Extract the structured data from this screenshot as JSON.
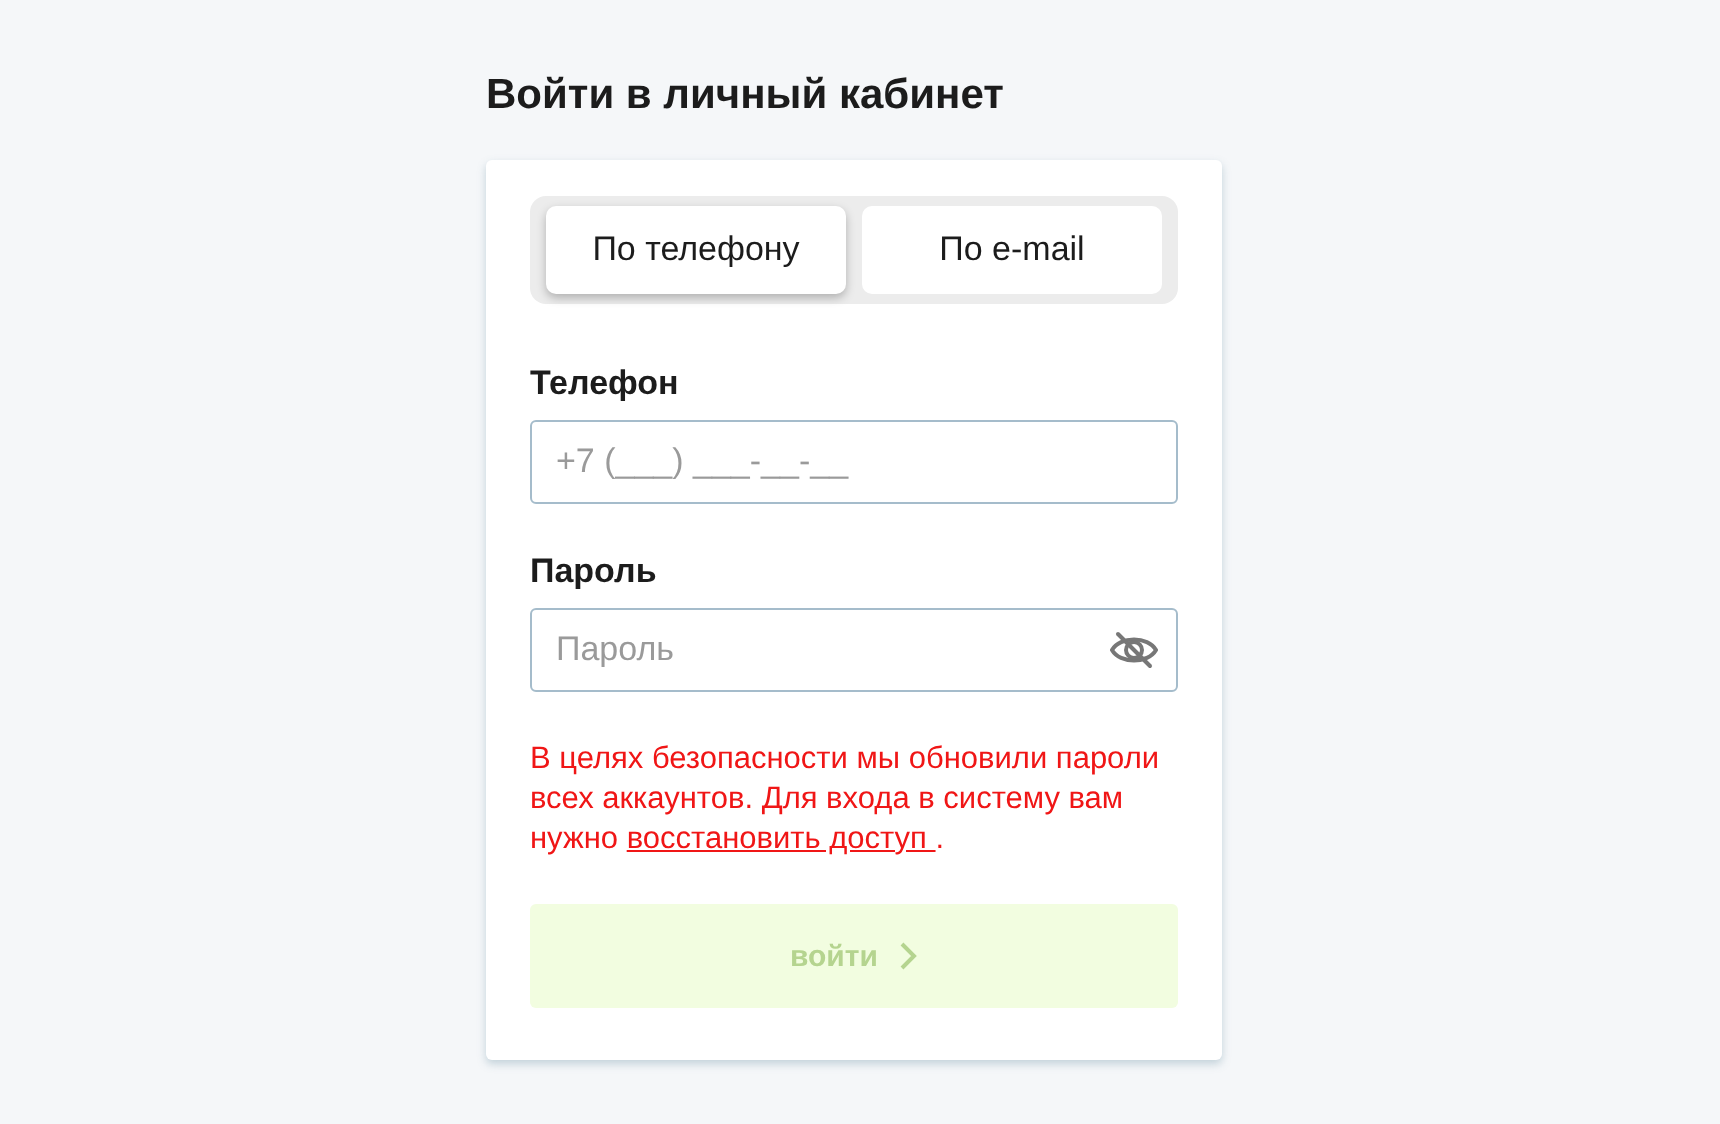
{
  "title": "Войти в личный кабинет",
  "tabs": [
    {
      "label": "По телефону",
      "selected": true
    },
    {
      "label": "По e-mail",
      "selected": false
    }
  ],
  "fields": [
    {
      "label": "Телефон",
      "placeholder": "+7 (___) ___-__-__",
      "kind": "phone"
    },
    {
      "label": "Пароль",
      "placeholder": "Пароль",
      "kind": "password"
    }
  ],
  "notice": {
    "text": "В целях безопасности мы обновили пароли всех аккаунтов. Для входа в систему вам нужно ",
    "link": "восстановить доступ ",
    "tail": "."
  },
  "submit": {
    "label": "войти",
    "disabled": true
  }
}
